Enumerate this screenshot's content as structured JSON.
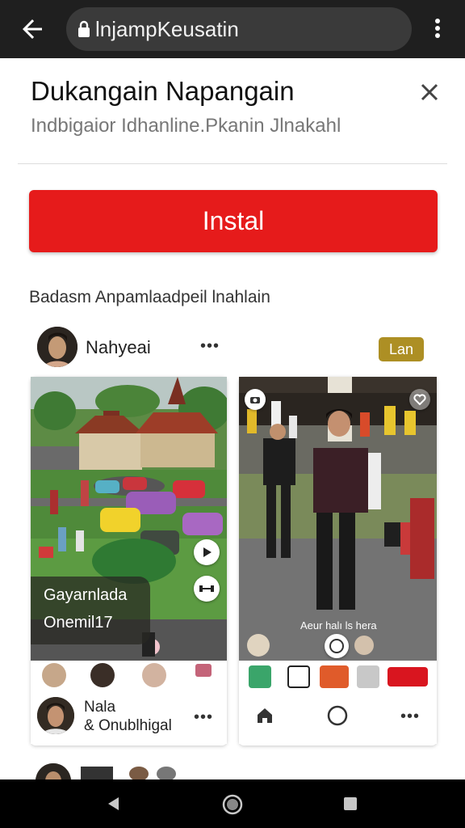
{
  "browser": {
    "url_text": "lnjampKeusatin"
  },
  "dialog": {
    "title": "Dukangain Napangain",
    "subtitle": "Indbigaior Idhanline.Pkanin Jlnakahl",
    "install_label": "Instal"
  },
  "section": {
    "heading": "Badasm Anpamlaadpeil lnahlain"
  },
  "post": {
    "username": "Nahyeai",
    "badge": "Lan",
    "left_overlay_line1": "Gayarnlada",
    "left_overlay_line2": "Onemil17",
    "right_caption": "Aeur halı ls hera"
  },
  "cards": {
    "left_user_name": "Nala",
    "left_user_handle": "& Onublhigal"
  },
  "colors": {
    "topbar_bg": "#1f1f1f",
    "install_bg": "#e61b1b",
    "badge_bg": "#ad8f24"
  },
  "icons": {
    "back": "back-arrow-icon",
    "lock": "lock-icon",
    "menu": "more-vert-icon",
    "close": "close-icon",
    "heart": "heart-icon"
  }
}
